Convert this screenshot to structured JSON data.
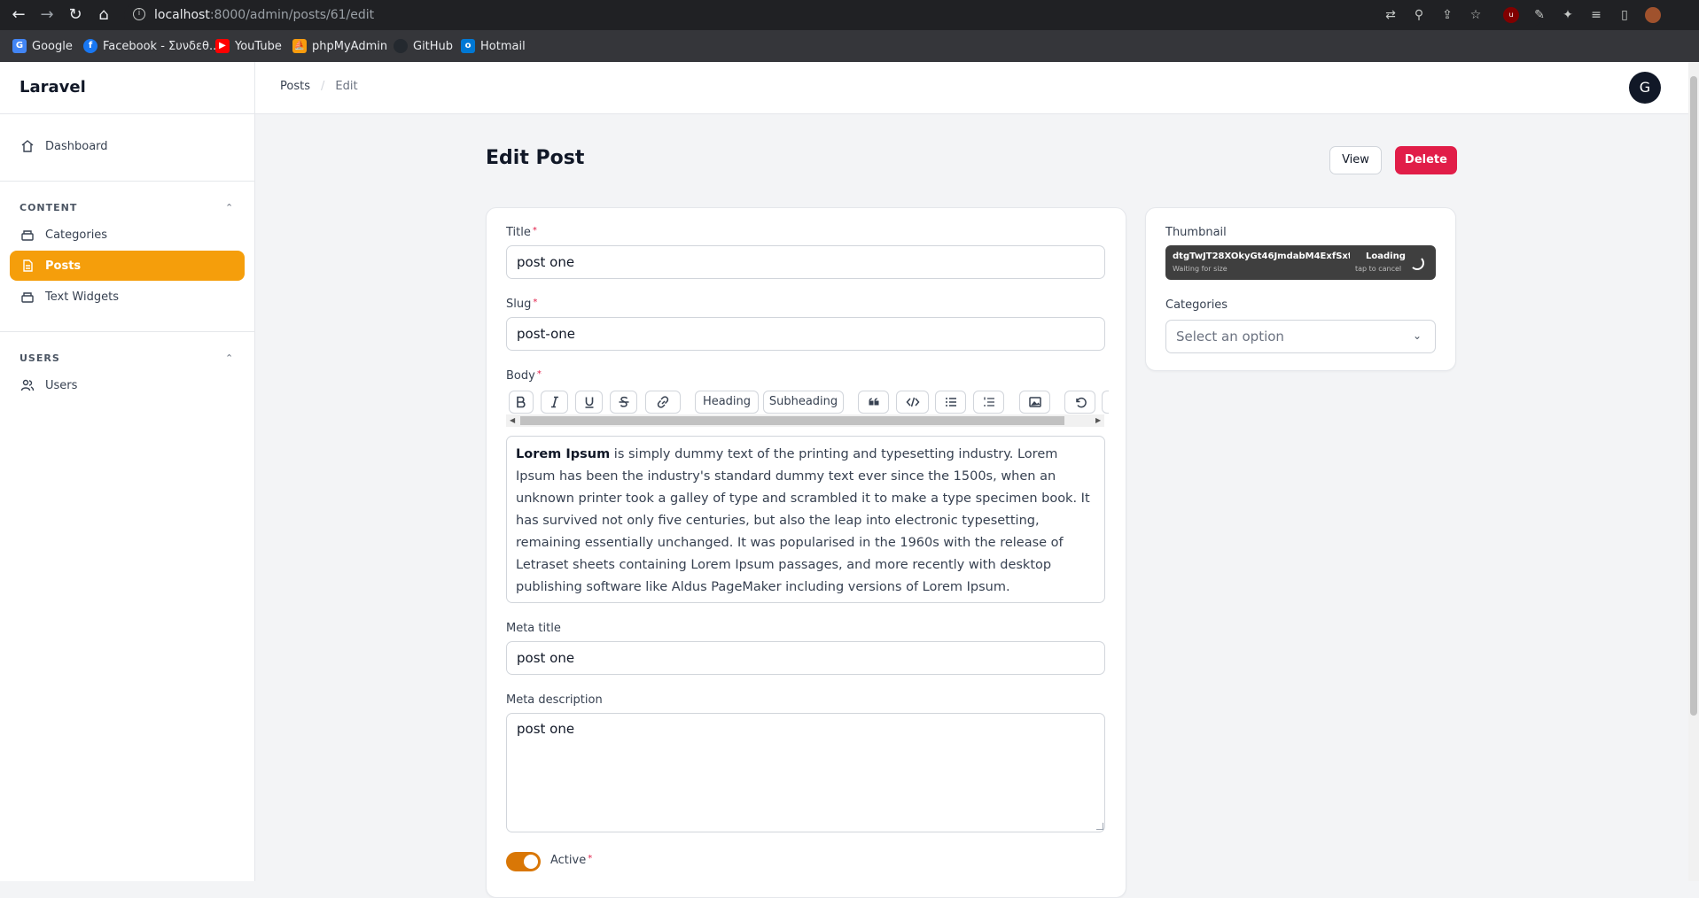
{
  "browser": {
    "url_host": "localhost",
    "url_path": ":8000/admin/posts/61/edit",
    "bookmarks": [
      {
        "label": "Google",
        "icon": "google-icon",
        "color": "#4285f4"
      },
      {
        "label": "Facebook - Συνδεθ...",
        "icon": "facebook-icon",
        "color": "#1877f2"
      },
      {
        "label": "YouTube",
        "icon": "youtube-icon",
        "color": "#ff0000"
      },
      {
        "label": "phpMyAdmin",
        "icon": "phpmyadmin-icon",
        "color": "#f89c0e"
      },
      {
        "label": "GitHub",
        "icon": "github-icon",
        "color": "#24292f"
      },
      {
        "label": "Hotmail",
        "icon": "outlook-icon",
        "color": "#0078d4"
      }
    ]
  },
  "sidebar": {
    "brand": "Laravel",
    "dashboard": "Dashboard",
    "content_group": "CONTENT",
    "categories": "Categories",
    "posts": "Posts",
    "text_widgets": "Text Widgets",
    "users_group": "USERS",
    "users": "Users",
    "accent": "#f59e0b"
  },
  "header": {
    "crumb_root": "Posts",
    "crumb_sep": "/",
    "crumb_current": "Edit",
    "avatar_initial": "G"
  },
  "page": {
    "title": "Edit Post",
    "view_label": "View",
    "delete_label": "Delete"
  },
  "form": {
    "title_label": "Title",
    "title_value": "post one",
    "slug_label": "Slug",
    "slug_value": "post-one",
    "body_label": "Body",
    "req_mark": "*",
    "toolbar": {
      "heading": "Heading",
      "subheading": "Subheading"
    },
    "body_bold": "Lorem Ipsum",
    "body_text": " is simply dummy text of the printing and typesetting industry. Lorem Ipsum has been the industry's standard dummy text ever since the 1500s, when an unknown printer took a galley of type and scrambled it to make a type specimen book. It has survived not only five centuries, but also the leap into electronic typesetting, remaining essentially unchanged. It was popularised in the 1960s with the release of Letraset sheets containing Lorem Ipsum passages, and more recently with desktop publishing software like Aldus PageMaker including versions of Lorem Ipsum.",
    "meta_title_label": "Meta title",
    "meta_title_value": "post one",
    "meta_desc_label": "Meta description",
    "meta_desc_value": "post one",
    "active_label": "Active"
  },
  "side_card": {
    "thumbnail_label": "Thumbnail",
    "thumb_filename": "dtgTwJT28XOkyGt46JmdabM4ExfSxt-m...",
    "thumb_wait": "Waiting for size",
    "thumb_loading": "Loading",
    "thumb_cancel": "tap to cancel",
    "categories_label": "Categories",
    "categories_placeholder": "Select an option"
  }
}
